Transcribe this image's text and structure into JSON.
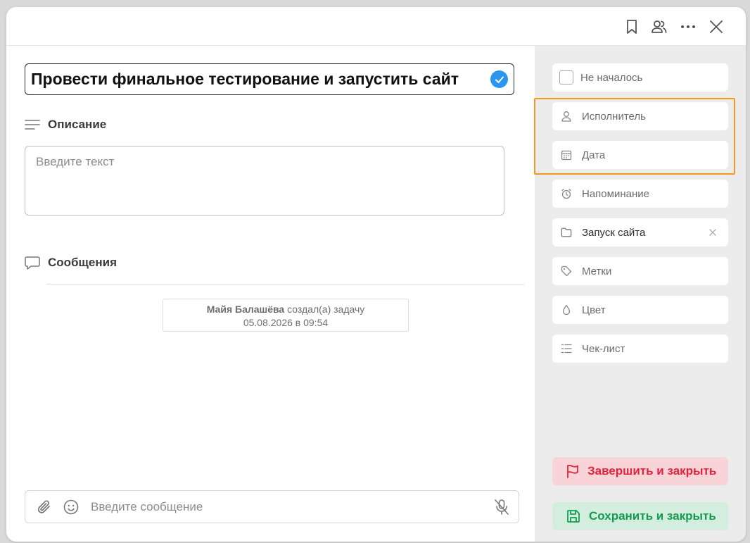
{
  "task": {
    "title": "Провести финальное тестирование и запустить сайт"
  },
  "description": {
    "label": "Описание",
    "placeholder": "Введите текст"
  },
  "messages": {
    "label": "Сообщения",
    "system": {
      "author": "Майя Балашёва",
      "action": "создал(а) задачу",
      "datetime": "05.08.2026 в 09:54"
    },
    "composer_placeholder": "Введите сообщение"
  },
  "sidebar": {
    "status": "Не началось",
    "assignee": "Исполнитель",
    "date": "Дата",
    "reminder": "Напоминание",
    "project": "Запуск сайта",
    "tags": "Метки",
    "color": "Цвет",
    "checklist": "Чек-лист"
  },
  "actions": {
    "finish": "Завершить и закрыть",
    "save": "Сохранить и закрыть"
  },
  "colors": {
    "accent_blue": "#2b96f0",
    "finish_red": "#e2233c",
    "save_green": "#139c4f",
    "highlight_orange": "#f39a1e"
  }
}
